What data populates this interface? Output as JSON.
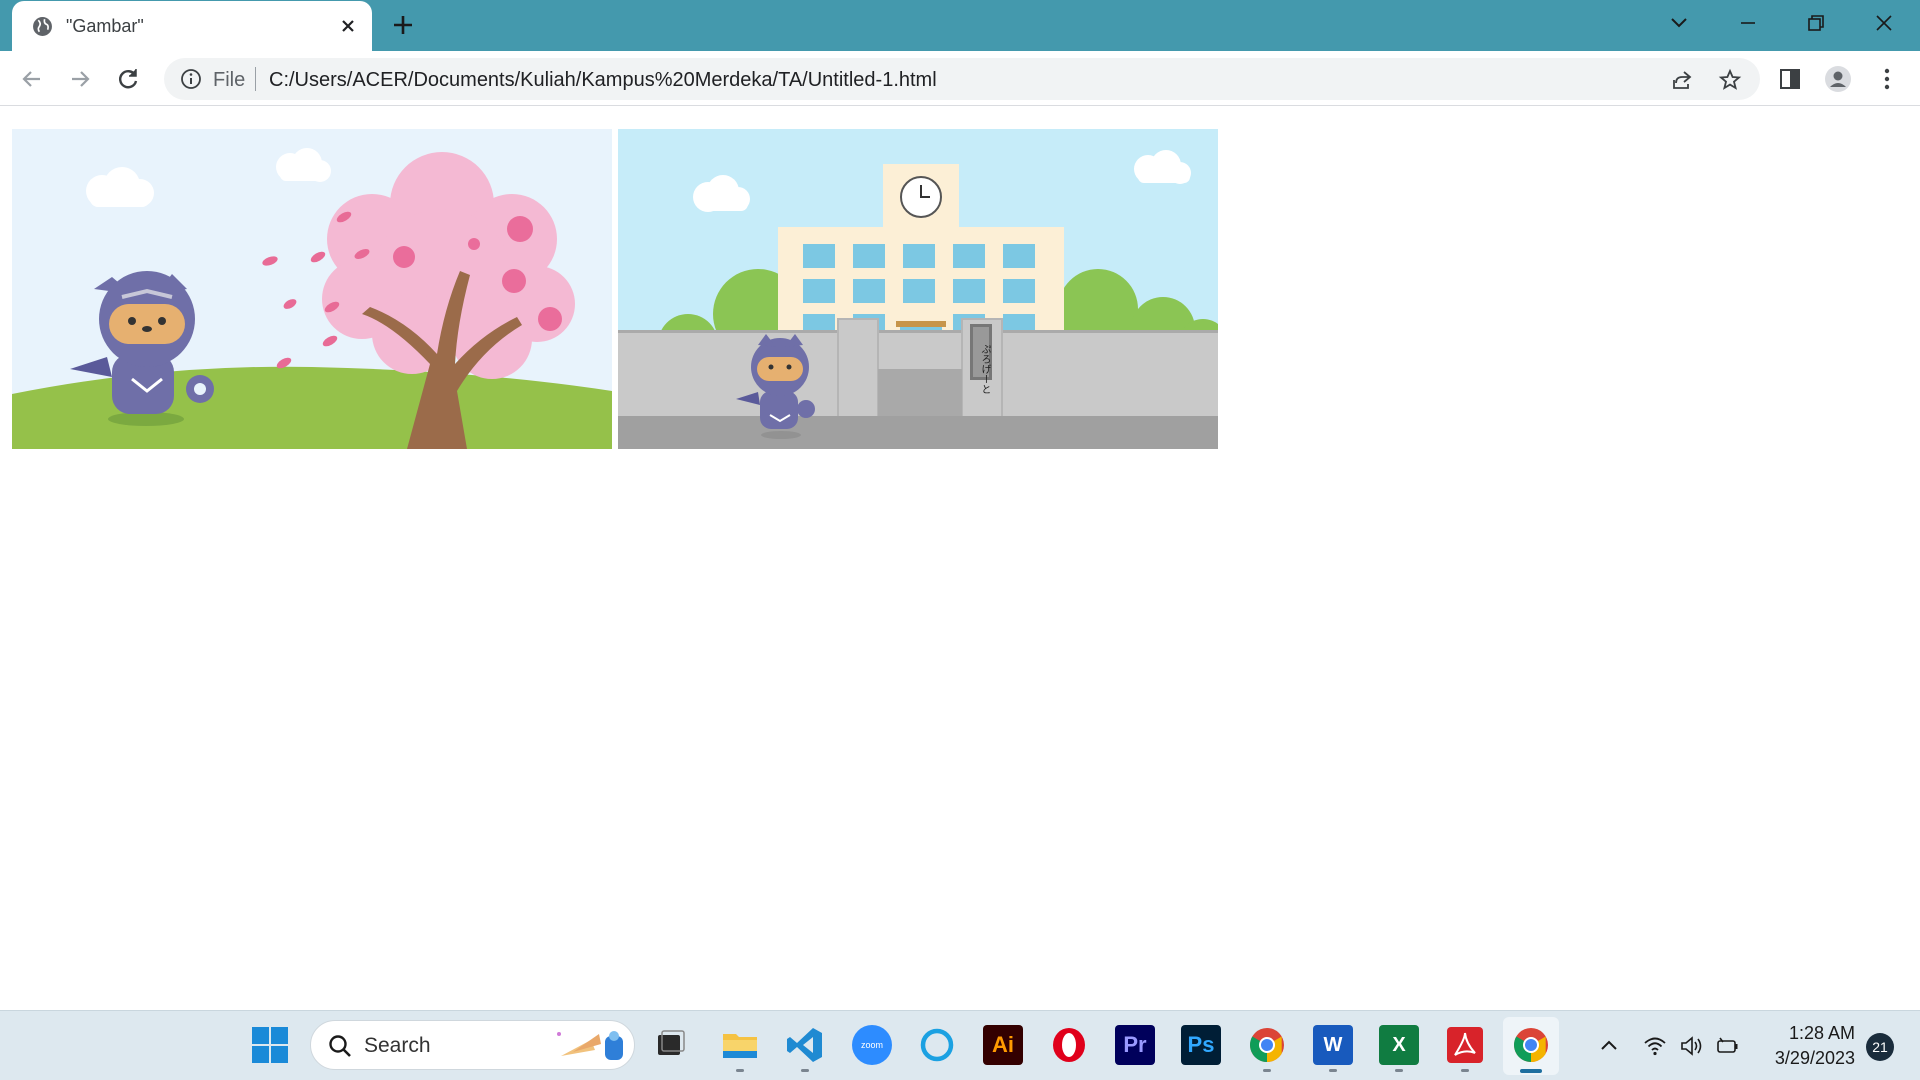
{
  "browser": {
    "tab": {
      "title": "\"Gambar\""
    },
    "omnibox": {
      "scheme_label": "File",
      "url": "C:/Users/ACER/Documents/Kuliah/Kampus%20Merdeka/TA/Untitled-1.html"
    }
  },
  "page": {
    "images": [
      {
        "name": "ninja-cat-cherry-blossom"
      },
      {
        "name": "ninja-cat-school-building",
        "sign_text": "ぷろげーと"
      }
    ]
  },
  "taskbar": {
    "search_label": "Search",
    "apps": [
      "Windows",
      "File Explorer",
      "VS Code",
      "Zoom",
      "Cortana",
      "Illustrator",
      "Opera",
      "Premiere Pro",
      "Photoshop",
      "Chrome",
      "Word",
      "Excel",
      "Acrobat",
      "Chrome"
    ],
    "zoom_label": "zoom",
    "ai_label": "Ai",
    "pr_label": "Pr",
    "ps_label": "Ps",
    "word_label": "W",
    "excel_label": "X",
    "time": "1:28 AM",
    "date": "3/29/2023",
    "notification_count": "21"
  }
}
